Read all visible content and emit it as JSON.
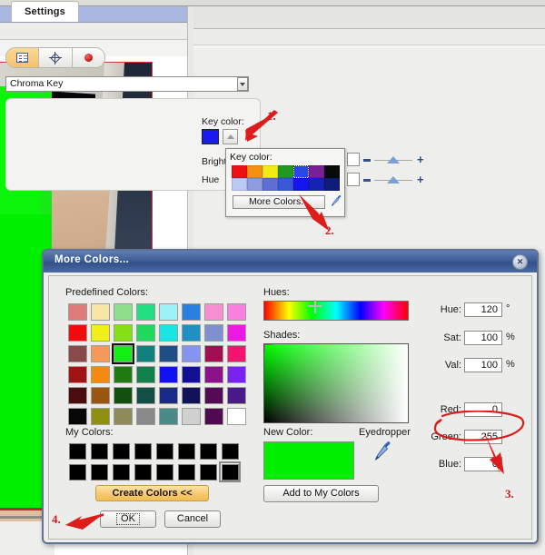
{
  "app": {
    "settings_tab": "Settings",
    "effect_select": "Chroma Key",
    "mode_buttons": [
      {
        "name": "properties-list",
        "icon": "list-icon"
      },
      {
        "name": "position-crosshair",
        "icon": "crosshair-icon"
      },
      {
        "name": "record",
        "icon": "record-icon"
      }
    ]
  },
  "chroma": {
    "key_color_label": "Key color:",
    "key_color_value": "#1a1aee",
    "brightness_label": "Brightness",
    "hue_label": "Hue"
  },
  "key_popup": {
    "title": "Key color:",
    "more_colors_label": "More Colors...",
    "eyedropper_name": "eyedropper-icon",
    "row1": [
      "#ef1111",
      "#f58f12",
      "#f2ea14",
      "#1f9a20",
      "#2a48e8",
      "#7a1f96",
      "#0a0a0a"
    ],
    "row2": [
      "#bcc9f2",
      "#8f9ce0",
      "#5d6fd6",
      "#3a57d8",
      "#1414f0",
      "#1622b4",
      "#101a78",
      "#0c1158"
    ],
    "selected_index": 4
  },
  "annotations": {
    "step1": "1.",
    "step2": "2.",
    "step3": "3.",
    "step4": "4."
  },
  "dialog": {
    "title": "More Colors...",
    "close_glyph": "✕",
    "predefined_label": "Predefined Colors:",
    "my_colors_label": "My Colors:",
    "hues_label": "Hues:",
    "shades_label": "Shades:",
    "new_color_label": "New Color:",
    "eyedropper_label": "Eyedropper",
    "create_colors_label": "Create Colors <<",
    "ok_label": "OK",
    "cancel_label": "Cancel",
    "add_to_my_colors_label": "Add to My Colors",
    "new_color_value": "#00f000",
    "selected_predefined_index": 18,
    "predefined_colors": [
      "#e07b7b",
      "#fae5a8",
      "#8ede8a",
      "#22dd84",
      "#9ef3f6",
      "#2a7fe0",
      "#f58fd0",
      "#f97fe0",
      "#f50a0a",
      "#f0ef16",
      "#86e016",
      "#1fd85c",
      "#17e6e6",
      "#1f8fc4",
      "#7f8fd0",
      "#ef18e2",
      "#8a4a4a",
      "#f59a58",
      "#12ef12",
      "#12807f",
      "#1d4f84",
      "#8595ef",
      "#a01050",
      "#f41470",
      "#a01414",
      "#f58a12",
      "#1f7a12",
      "#12804a",
      "#1212f0",
      "#101090",
      "#8c128c",
      "#7a22f0",
      "#4a0c0c",
      "#9a5510",
      "#12500f",
      "#124f47",
      "#1a2a8a",
      "#12125a",
      "#550a55",
      "#4a1a8c",
      "#080808",
      "#8f8f12",
      "#8f8a5a",
      "#8a8a8a",
      "#4a8a8a",
      "#d0d0d0",
      "#500a50",
      "#ffffff"
    ],
    "my_colors": [
      "#000000",
      "#000000",
      "#000000",
      "#000000",
      "#000000",
      "#000000",
      "#000000",
      "#000000",
      "#000000",
      "#000000",
      "#000000",
      "#000000",
      "#000000",
      "#000000",
      "#000000",
      "#000000"
    ],
    "my_colors_selected_index": 15,
    "values": [
      {
        "label": "Hue:",
        "value": "120",
        "unit": "°",
        "name": "hue"
      },
      {
        "label": "Sat:",
        "value": "100",
        "unit": "%",
        "name": "sat"
      },
      {
        "label": "Val:",
        "value": "100",
        "unit": "%",
        "name": "val"
      },
      {
        "label": "Red:",
        "value": "0",
        "unit": "",
        "name": "red"
      },
      {
        "label": "Green:",
        "value": "255",
        "unit": "",
        "name": "green"
      },
      {
        "label": "Blue:",
        "value": "0",
        "unit": "",
        "name": "blue"
      }
    ]
  }
}
